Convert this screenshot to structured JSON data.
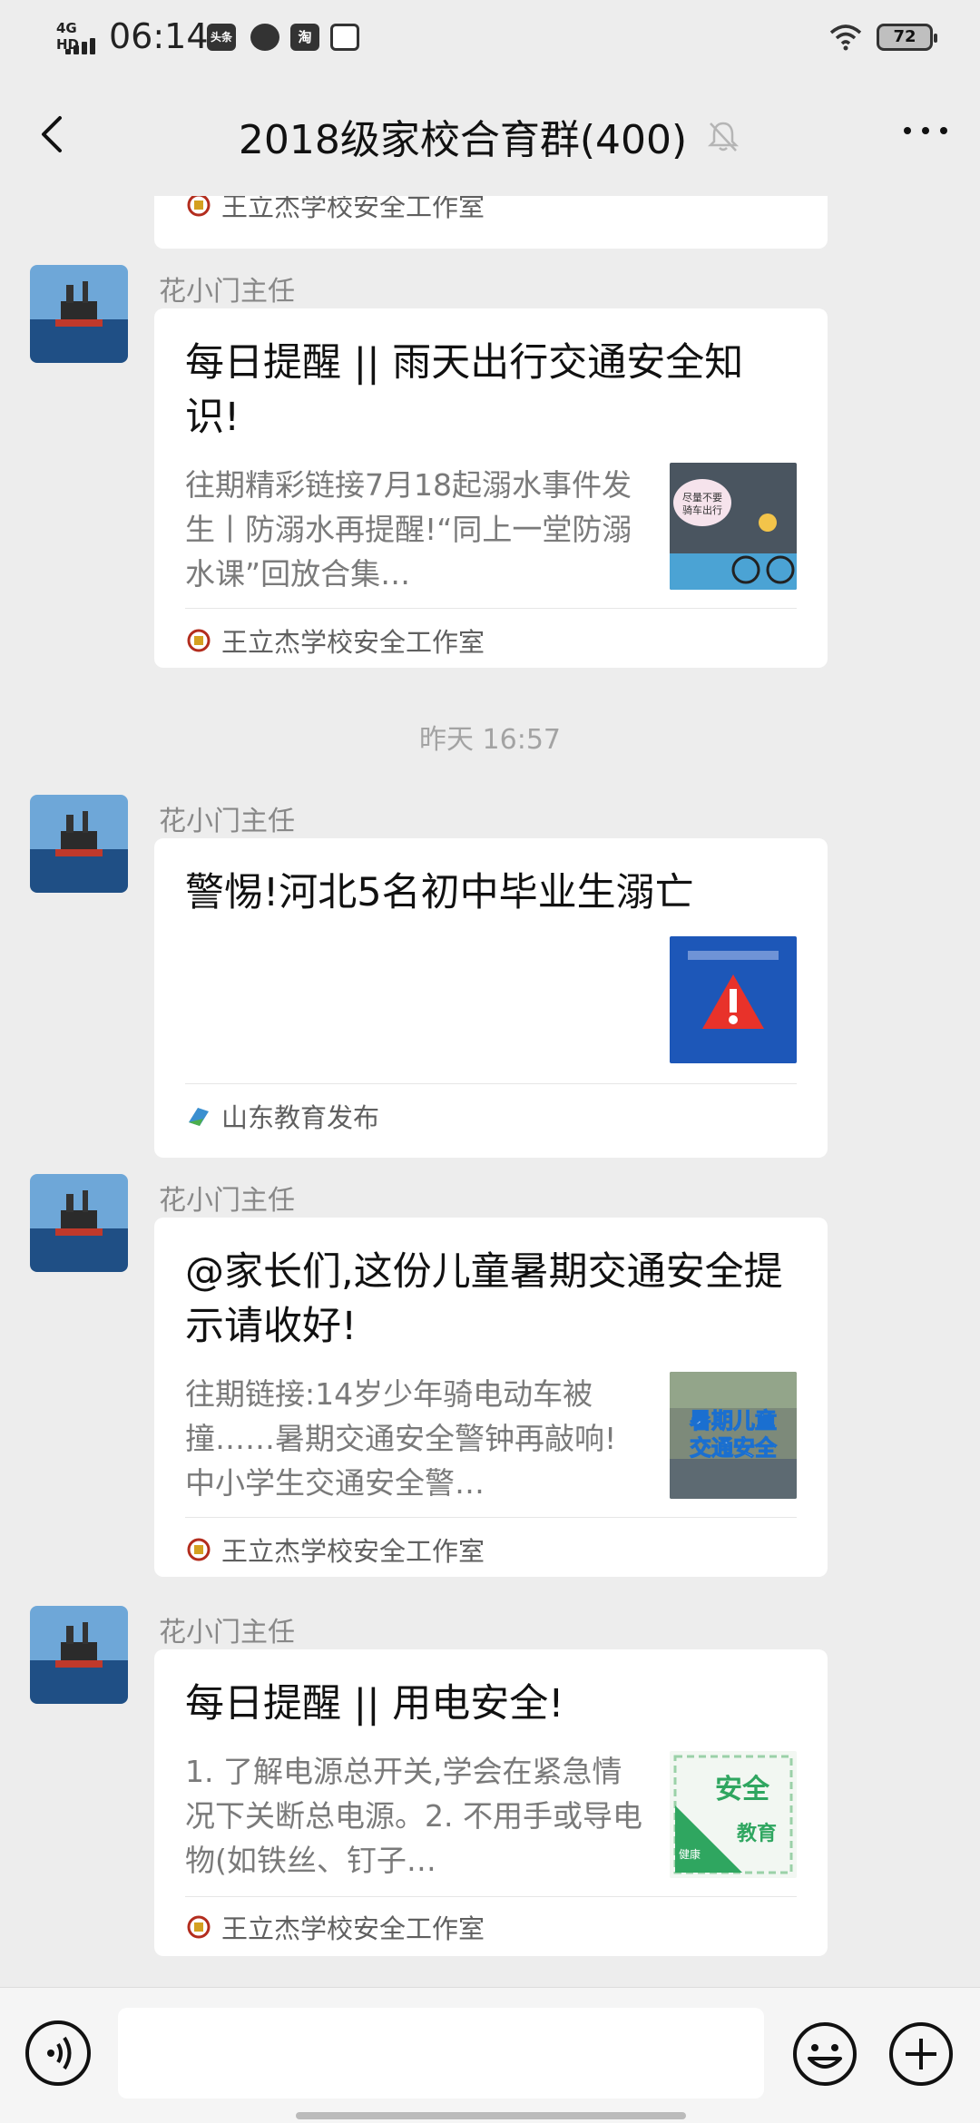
{
  "status_bar": {
    "network": "4G HD",
    "time": "06:14",
    "notif_icons": [
      "头条",
      "chat-bubble-icon",
      "淘",
      "search-app-icon"
    ],
    "battery": "72"
  },
  "header": {
    "title": "2018级家校合育群(400)",
    "back_icon": "chevron-left-icon",
    "mute_icon": "bell-off-icon",
    "more_icon": "more-dots-icon"
  },
  "messages": [
    {
      "type": "article-tail",
      "source": "王立杰学校安全工作室"
    },
    {
      "type": "article",
      "sender": "花小门主任",
      "title": "每日提醒 || 雨天出行交通安全知识!",
      "desc": "往期精彩链接7月18起溺水事件发生丨防溺水再提醒!“同上一堂防溺水课”回放合集…",
      "thumb_text": "尽量不要骑车出行",
      "source": "王立杰学校安全工作室"
    },
    {
      "type": "time",
      "text": "昨天 16:57"
    },
    {
      "type": "article",
      "sender": "花小门主任",
      "title": "警惕!河北5名初中毕业生溺亡",
      "desc": "",
      "source": "山东教育发布"
    },
    {
      "type": "article",
      "sender": "花小门主任",
      "title": "@家长们,这份儿童暑期交通安全提示请收好!",
      "desc": "往期链接:14岁少年骑电动车被撞……暑期交通安全警钟再敲响!中小学生交通安全警…",
      "thumb_text": "暑期儿童 交通安全",
      "source": "王立杰学校安全工作室"
    },
    {
      "type": "article",
      "sender": "花小门主任",
      "title": "每日提醒 || 用电安全!",
      "desc": "1. 了解电源总开关,学会在紧急情况下关断总电源。2. 不用手或导电物(如铁丝、钉子…",
      "thumb_text_main": "安全",
      "thumb_text_sub": "教育",
      "thumb_text_side": "健康",
      "source": "王立杰学校安全工作室"
    }
  ],
  "input_bar": {
    "voice_icon": "voice-icon",
    "placeholder": "",
    "emoji_icon": "emoji-icon",
    "plus_icon": "plus-icon"
  },
  "colors": {
    "background": "#ededed",
    "card": "#ffffff",
    "title_text": "#111111",
    "desc_text": "#7a7a7a",
    "sender_text": "#888888"
  }
}
